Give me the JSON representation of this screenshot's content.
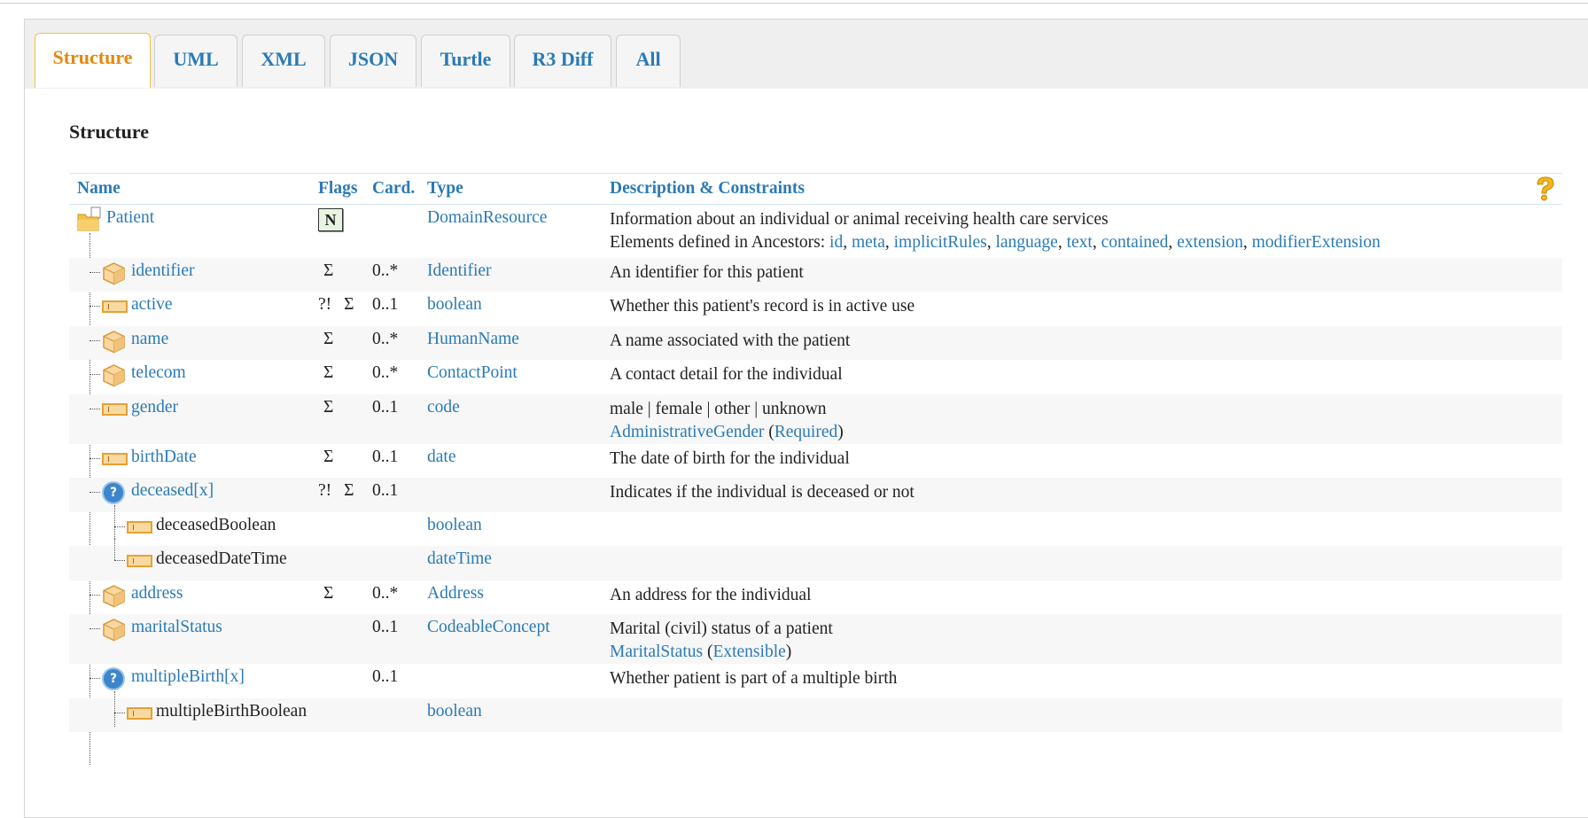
{
  "tabs": [
    {
      "label": "Structure",
      "active": true
    },
    {
      "label": "UML"
    },
    {
      "label": "XML"
    },
    {
      "label": "JSON"
    },
    {
      "label": "Turtle"
    },
    {
      "label": "R3 Diff"
    },
    {
      "label": "All"
    }
  ],
  "section_title": "Structure",
  "columns": {
    "name": "Name",
    "flags": "Flags",
    "card": "Card.",
    "type": "Type",
    "desc": "Description & Constraints"
  },
  "help_icon": "question-mark-icon",
  "root": {
    "name": "Patient",
    "flag": "N",
    "type": "DomainResource",
    "desc": "Information about an individual or animal receiving health care services",
    "ancestors_label": "Elements defined in Ancestors: ",
    "ancestors": [
      "id",
      "meta",
      "implicitRules",
      "language",
      "text",
      "contained",
      "extension",
      "modifierExtension"
    ]
  },
  "rows": [
    {
      "name": "identifier",
      "icon": "datatype-cube-icon",
      "mod": "",
      "sigma": "Σ",
      "card": "0..*",
      "type": "Identifier",
      "desc": "An identifier for this patient"
    },
    {
      "name": "active",
      "icon": "primitive-icon",
      "mod": "?!",
      "sigma": "Σ",
      "card": "0..1",
      "type": "boolean",
      "desc": "Whether this patient's record is in active use"
    },
    {
      "name": "name",
      "icon": "datatype-cube-icon",
      "mod": "",
      "sigma": "Σ",
      "card": "0..*",
      "type": "HumanName",
      "desc": "A name associated with the patient"
    },
    {
      "name": "telecom",
      "icon": "datatype-cube-icon",
      "mod": "",
      "sigma": "Σ",
      "card": "0..*",
      "type": "ContactPoint",
      "desc": "A contact detail for the individual"
    },
    {
      "name": "gender",
      "icon": "primitive-icon",
      "mod": "",
      "sigma": "Σ",
      "card": "0..1",
      "type": "code",
      "desc": "male | female | other | unknown",
      "binding": "AdministrativeGender",
      "strength": "Required"
    },
    {
      "name": "birthDate",
      "icon": "primitive-icon",
      "mod": "",
      "sigma": "Σ",
      "card": "0..1",
      "type": "date",
      "desc": "The date of birth for the individual"
    },
    {
      "name": "deceased[x]",
      "icon": "choice-icon",
      "mod": "?!",
      "sigma": "Σ",
      "card": "0..1",
      "type": "",
      "desc": "Indicates if the individual is deceased or not"
    },
    {
      "name": "deceasedBoolean",
      "icon": "primitive-icon",
      "child": true,
      "mod": "",
      "sigma": "",
      "card": "",
      "type": "boolean",
      "desc": ""
    },
    {
      "name": "deceasedDateTime",
      "icon": "primitive-icon",
      "child": true,
      "mod": "",
      "sigma": "",
      "card": "",
      "type": "dateTime",
      "desc": ""
    },
    {
      "name": "address",
      "icon": "datatype-cube-icon",
      "mod": "",
      "sigma": "Σ",
      "card": "0..*",
      "type": "Address",
      "desc": "An address for the individual"
    },
    {
      "name": "maritalStatus",
      "icon": "datatype-cube-icon",
      "mod": "",
      "sigma": "",
      "card": "0..1",
      "type": "CodeableConcept",
      "desc": "Marital (civil) status of a patient",
      "binding": "MaritalStatus",
      "strength": "Extensible"
    },
    {
      "name": "multipleBirth[x]",
      "icon": "choice-icon",
      "mod": "",
      "sigma": "",
      "card": "0..1",
      "type": "",
      "desc": "Whether patient is part of a multiple birth"
    },
    {
      "name": "multipleBirthBoolean",
      "icon": "primitive-icon",
      "child": true,
      "mod": "",
      "sigma": "",
      "card": "",
      "type": "boolean",
      "desc": ""
    }
  ]
}
